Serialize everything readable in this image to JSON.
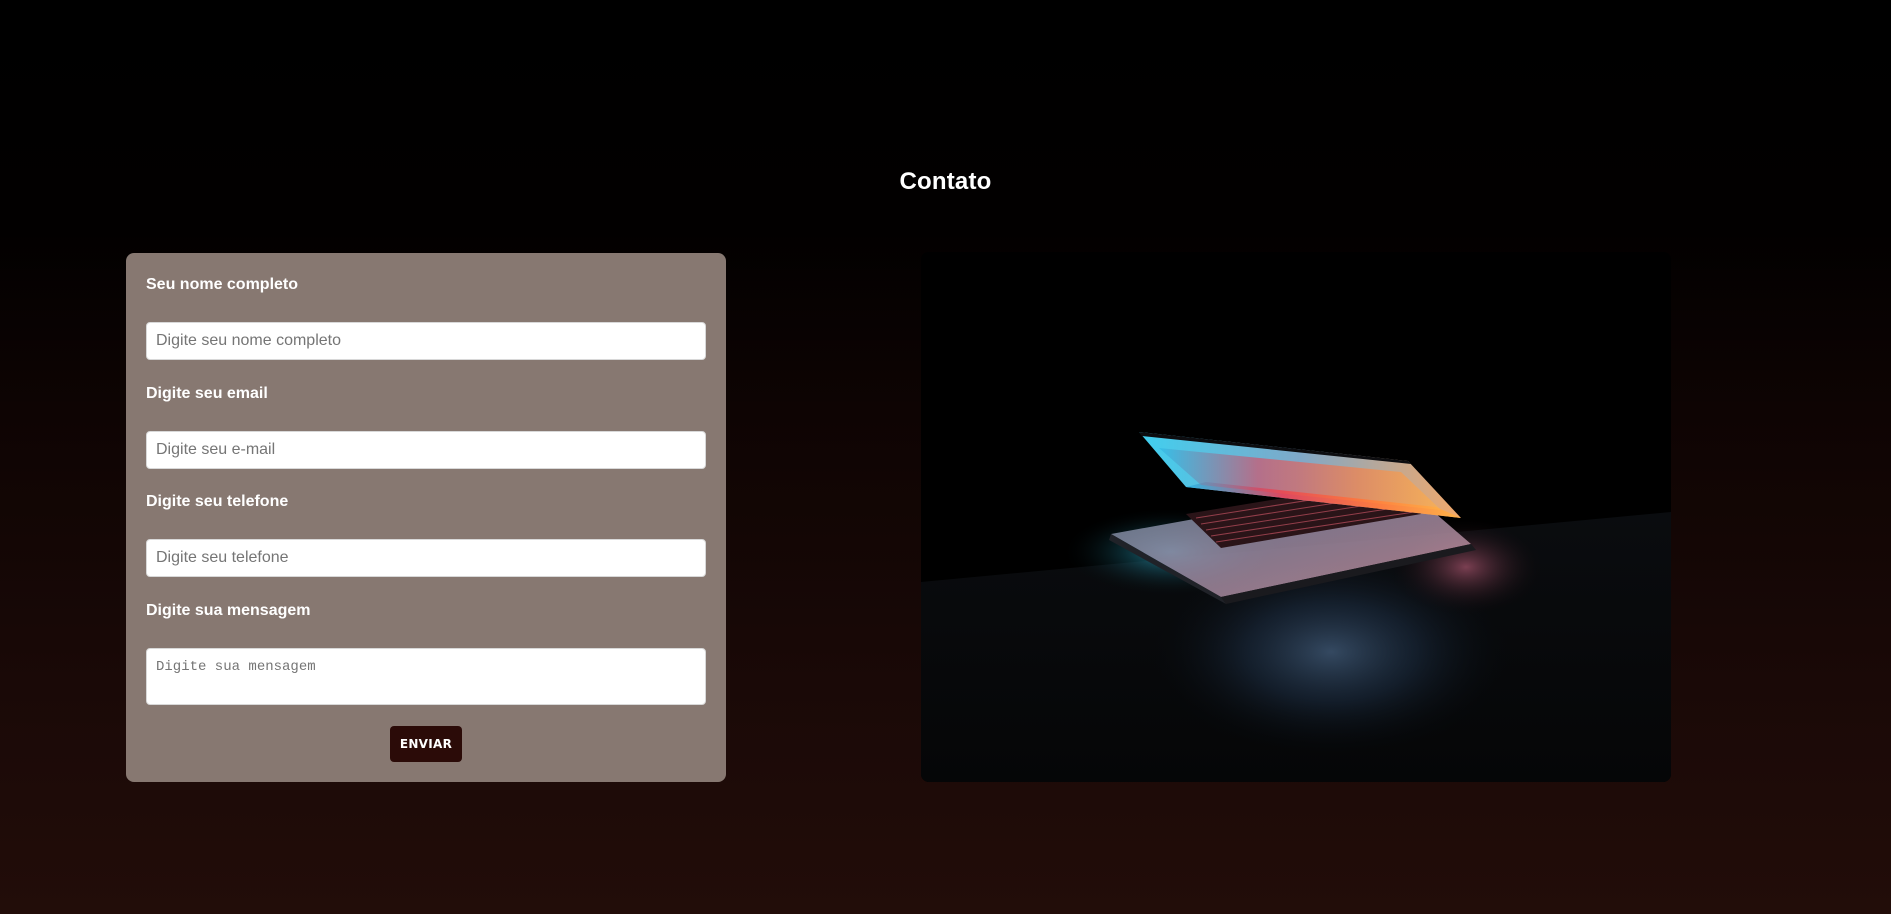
{
  "page": {
    "title": "Contato"
  },
  "form": {
    "name_label": "Seu nome completo",
    "name_placeholder": "Digite seu nome completo",
    "email_label": "Digite seu email",
    "email_placeholder": "Digite seu e-mail",
    "phone_label": "Digite seu telefone",
    "phone_placeholder": "Digite seu telefone",
    "message_label": "Digite sua mensagem",
    "message_placeholder": "Digite sua mensagem",
    "submit_label": "ENVIAR"
  },
  "image": {
    "subject": "laptop-in-dark-photo"
  },
  "colors": {
    "card_background": "#877871",
    "button_background": "#2b0b08",
    "page_gradient_bottom": "#220d09"
  }
}
